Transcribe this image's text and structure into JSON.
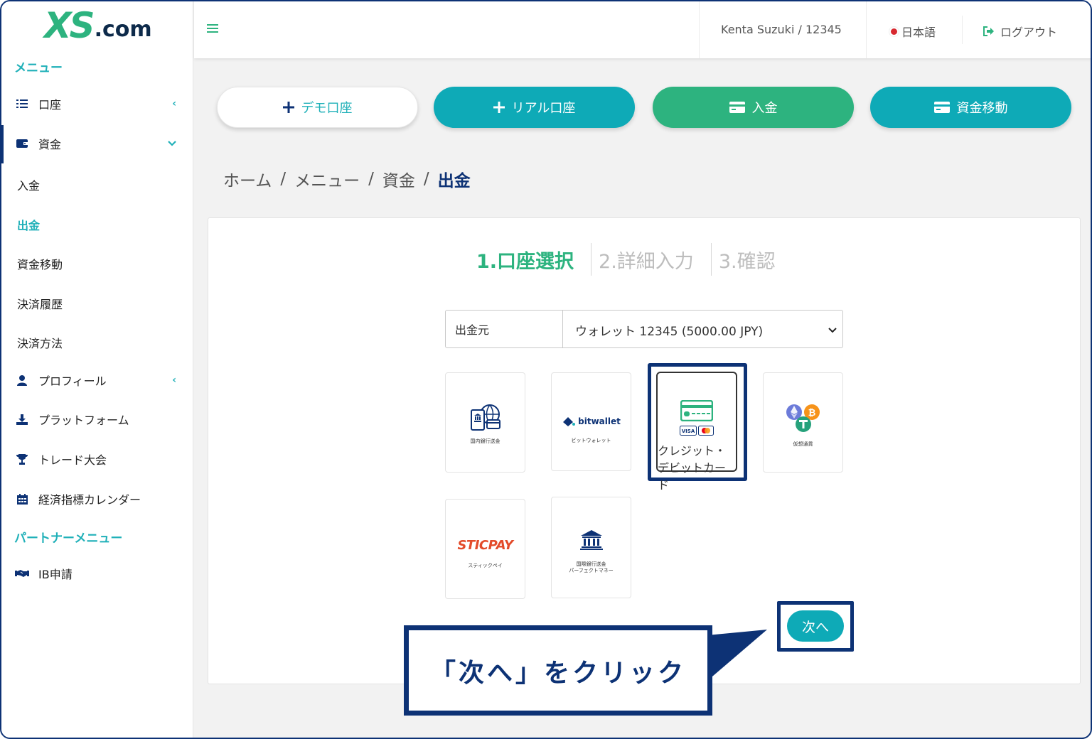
{
  "brand": {
    "logo_main": "XS",
    "logo_suffix": ".com"
  },
  "sidebar": {
    "menu_title": "メニュー",
    "items": [
      {
        "label": "口座",
        "icon": "list-icon",
        "chevron": "‹"
      },
      {
        "label": "資金",
        "icon": "wallet-icon",
        "chevron": "⌄"
      }
    ],
    "funds_sub": [
      "入金",
      "出金",
      "資金移動",
      "決済履歴",
      "決済方法"
    ],
    "items2": [
      {
        "label": "プロフィール",
        "icon": "user-icon",
        "chevron": "‹"
      },
      {
        "label": "プラットフォーム",
        "icon": "download-icon"
      },
      {
        "label": "トレード大会",
        "icon": "trophy-icon"
      },
      {
        "label": "経済指標カレンダー",
        "icon": "calendar-icon"
      }
    ],
    "partner_title": "パートナーメニュー",
    "partner_items": [
      {
        "label": "IB申請",
        "icon": "handshake-icon"
      }
    ]
  },
  "header": {
    "user": "Kenta Suzuki / 12345",
    "language": "日本語",
    "logout": "ログアウト"
  },
  "actions": {
    "demo": "デモ口座",
    "real": "リアル口座",
    "deposit": "入金",
    "transfer": "資金移動"
  },
  "breadcrumb": [
    "ホーム",
    "メニュー",
    "資金",
    "出金"
  ],
  "steps": [
    "1.口座選択",
    "2.詳細入力",
    "3.確認"
  ],
  "source": {
    "label": "出金元",
    "value": "ウォレット 12345 (5000.00 JPY)"
  },
  "methods": [
    {
      "label": "国内銀行送金"
    },
    {
      "brand": "bitwallet",
      "label": "ビットウォレット"
    },
    {
      "label": "クレジット・デビットカード",
      "selected": true
    },
    {
      "label": "仮想通貨"
    },
    {
      "brand": "STICPAY",
      "label": "スティックペイ"
    },
    {
      "label": "国際銀行送金\nパーフェクトマネー"
    }
  ],
  "next_button": "次へ",
  "callout": "「次へ」をクリック",
  "colors": {
    "teal": "#0eaab7",
    "green": "#2db37f",
    "navy": "#0d3275"
  }
}
